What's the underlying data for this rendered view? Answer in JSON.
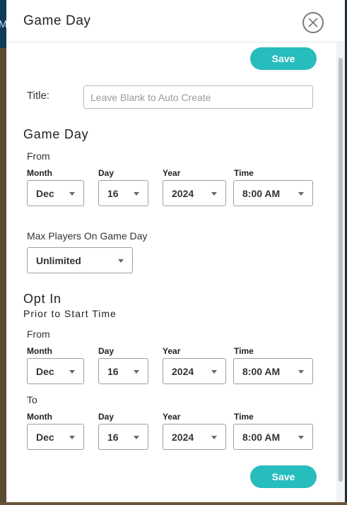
{
  "background": {
    "partial_text": "Me"
  },
  "modal": {
    "title": "Game Day",
    "save_label": "Save"
  },
  "title_field": {
    "label": "Title:",
    "value": "",
    "placeholder": "Leave Blank to Auto Create"
  },
  "game_day": {
    "heading": "Game Day",
    "from_label": "From",
    "column_labels": {
      "month": "Month",
      "day": "Day",
      "year": "Year",
      "time": "Time"
    },
    "from": {
      "month": "Dec",
      "day": "16",
      "year": "2024",
      "time": "8:00 AM"
    },
    "max_players_label": "Max Players On Game Day",
    "max_players": "Unlimited"
  },
  "opt_in": {
    "heading": "Opt In",
    "subheading": "Prior to Start Time",
    "from_label": "From",
    "to_label": "To",
    "from": {
      "month": "Dec",
      "day": "16",
      "year": "2024",
      "time": "8:00 AM"
    },
    "to": {
      "month": "Dec",
      "day": "16",
      "year": "2024",
      "time": "8:00 AM"
    }
  },
  "colors": {
    "accent": "#27bdbd",
    "border": "#9e9e9e",
    "text": "#222222"
  }
}
